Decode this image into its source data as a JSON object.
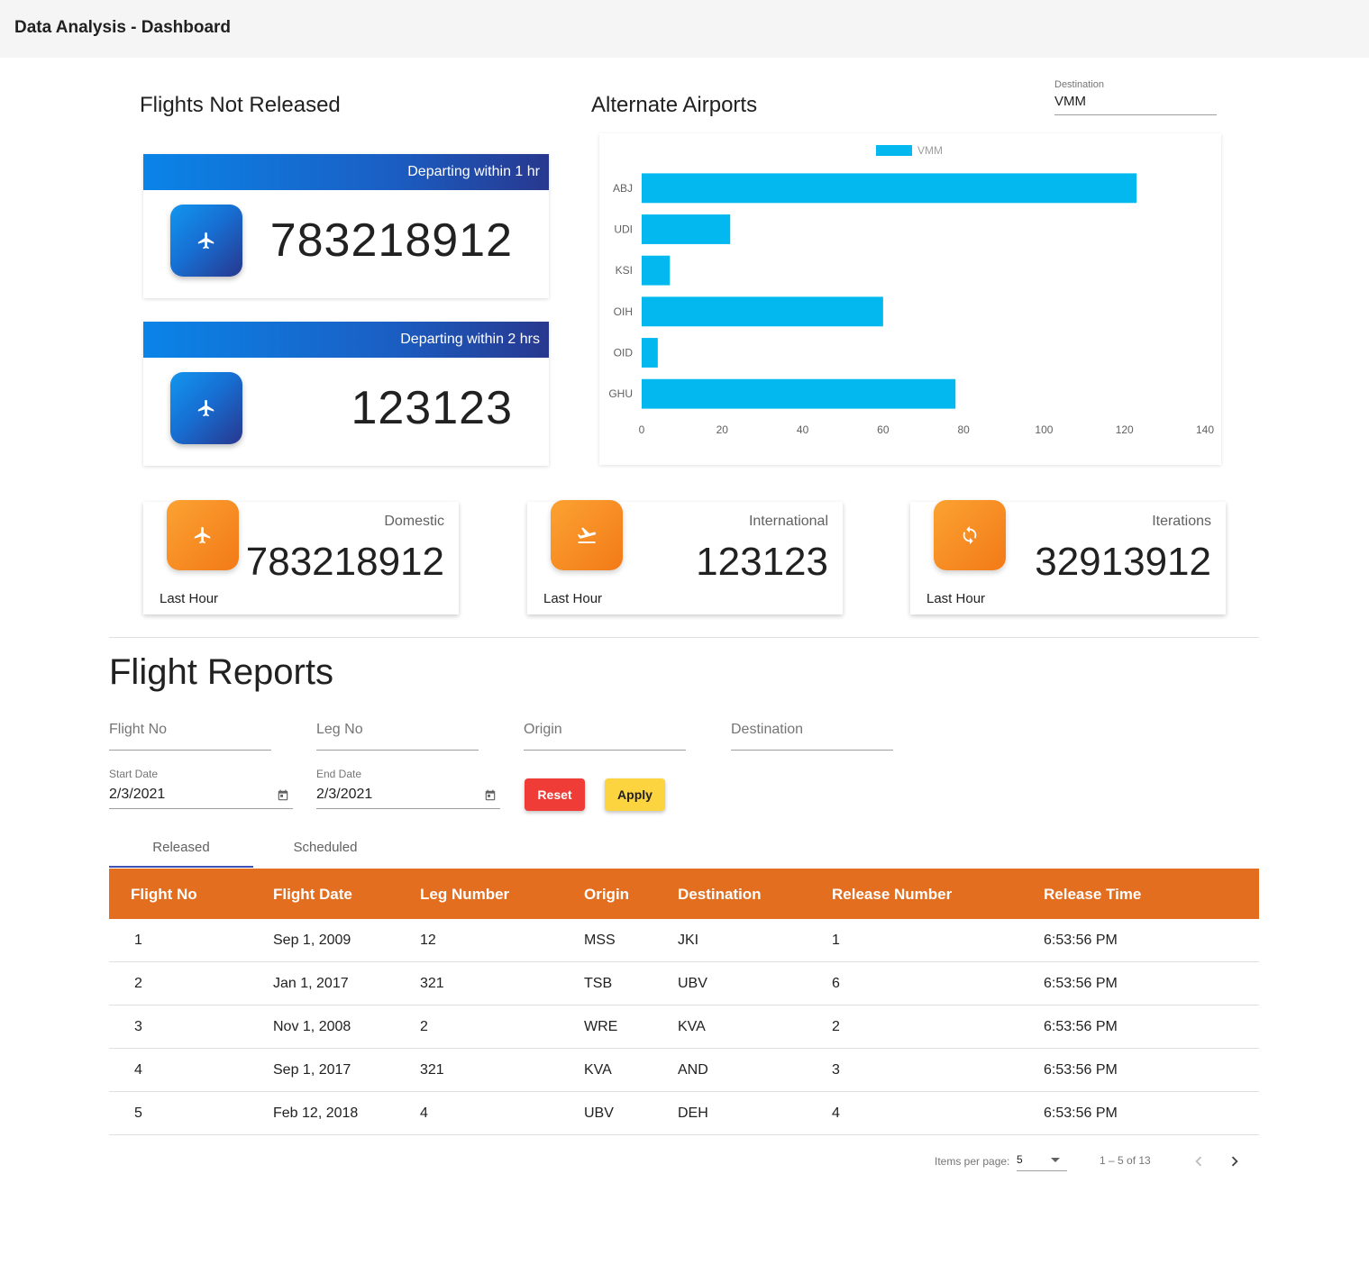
{
  "app": {
    "title": "Data Analysis - Dashboard"
  },
  "flights_not_released": {
    "title": "Flights Not Released",
    "cards": [
      {
        "header": "Departing within 1 hr",
        "value": "783218912",
        "icon": "airplane-icon"
      },
      {
        "header": "Departing within 2 hrs",
        "value": "123123",
        "icon": "airplane-icon"
      }
    ]
  },
  "alternate_airports": {
    "title": "Alternate Airports",
    "destination": {
      "label": "Destination",
      "value": "VMM"
    }
  },
  "chart_data": {
    "type": "bar",
    "orientation": "horizontal",
    "categories": [
      "ABJ",
      "UDI",
      "KSI",
      "OIH",
      "OID",
      "GHU"
    ],
    "series": [
      {
        "name": "VMM",
        "values": [
          123,
          22,
          7,
          60,
          4,
          78
        ],
        "color": "#03b8ee"
      }
    ],
    "xlim": [
      0,
      140
    ],
    "xticks": [
      "0",
      "20",
      "40",
      "60",
      "80",
      "100",
      "120",
      "140"
    ],
    "legend": "top",
    "grid": false
  },
  "stats": [
    {
      "label": "Domestic",
      "value": "783218912",
      "footer": "Last Hour",
      "icon": "airplane-icon"
    },
    {
      "label": "International",
      "value": "123123",
      "footer": "Last Hour",
      "icon": "flight-takeoff-icon"
    },
    {
      "label": "Iterations",
      "value": "32913912",
      "footer": "Last Hour",
      "icon": "sync-icon"
    }
  ],
  "reports": {
    "title": "Flight Reports",
    "filters": {
      "flight_no": "Flight No",
      "leg_no": "Leg No",
      "origin": "Origin",
      "destination": "Destination",
      "start_date": {
        "label": "Start Date",
        "value": "2/3/2021"
      },
      "end_date": {
        "label": "End Date",
        "value": "2/3/2021"
      }
    },
    "buttons": {
      "reset": "Reset",
      "apply": "Apply"
    },
    "tabs": [
      "Released",
      "Scheduled"
    ],
    "columns": [
      "Flight No",
      "Flight Date",
      "Leg Number",
      "Origin",
      "Destination",
      "Release Number",
      "Release Time"
    ],
    "rows": [
      [
        "1",
        "Sep 1, 2009",
        "12",
        "MSS",
        "JKI",
        "1",
        "6:53:56 PM"
      ],
      [
        "2",
        "Jan 1, 2017",
        "321",
        "TSB",
        "UBV",
        "6",
        "6:53:56 PM"
      ],
      [
        "3",
        "Nov 1, 2008",
        "2",
        "WRE",
        "KVA",
        "2",
        "6:53:56 PM"
      ],
      [
        "4",
        "Sep 1, 2017",
        "321",
        "KVA",
        "AND",
        "3",
        "6:53:56 PM"
      ],
      [
        "5",
        "Feb 12, 2018",
        "4",
        "UBV",
        "DEH",
        "4",
        "6:53:56 PM"
      ]
    ],
    "paginator": {
      "label": "Items per page:",
      "page_size": "5",
      "range": "1 – 5 of 13"
    }
  }
}
